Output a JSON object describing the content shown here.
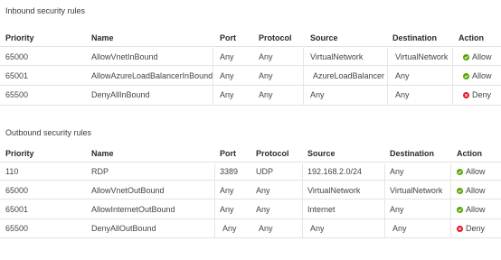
{
  "colors": {
    "allow": "#57a300",
    "deny": "#e81123"
  },
  "inbound": {
    "title": "Inbound security rules",
    "headers": {
      "priority": "Priority",
      "name": "Name",
      "port": "Port",
      "protocol": "Protocol",
      "source": "Source",
      "destination": "Destination",
      "action": "Action"
    },
    "rows": [
      {
        "priority": "65000",
        "name": "AllowVnetInBound",
        "port": "Any",
        "protocol": "Any",
        "source": "VirtualNetwork",
        "destination": "VirtualNetwork",
        "action": "Allow",
        "action_icon": "check-circle-icon"
      },
      {
        "priority": "65001",
        "name": "AllowAzureLoadBalancerInBound",
        "port": "Any",
        "protocol": "Any",
        "source": "AzureLoadBalancer",
        "destination": "Any",
        "action": "Allow",
        "action_icon": "check-circle-icon"
      },
      {
        "priority": "65500",
        "name": "DenyAllInBound",
        "port": "Any",
        "protocol": "Any",
        "source": "Any",
        "destination": "Any",
        "action": "Deny",
        "action_icon": "x-circle-icon"
      }
    ]
  },
  "outbound": {
    "title": "Outbound security rules",
    "headers": {
      "priority": "Priority",
      "name": "Name",
      "port": "Port",
      "protocol": "Protocol",
      "source": "Source",
      "destination": "Destination",
      "action": "Action"
    },
    "rows": [
      {
        "priority": "110",
        "name": "RDP",
        "port": "3389",
        "protocol": "UDP",
        "source": "192.168.2.0/24",
        "destination": "Any",
        "action": "Allow",
        "action_icon": "check-circle-icon"
      },
      {
        "priority": "65000",
        "name": "AllowVnetOutBound",
        "port": "Any",
        "protocol": "Any",
        "source": "VirtualNetwork",
        "destination": "VirtualNetwork",
        "action": "Allow",
        "action_icon": "check-circle-icon"
      },
      {
        "priority": "65001",
        "name": "AllowInternetOutBound",
        "port": "Any",
        "protocol": "Any",
        "source": "Internet",
        "destination": "Any",
        "action": "Allow",
        "action_icon": "check-circle-icon"
      },
      {
        "priority": "65500",
        "name": "DenyAllOutBound",
        "port": "Any",
        "protocol": "Any",
        "source": "Any",
        "destination": "Any",
        "action": "Deny",
        "action_icon": "x-circle-icon"
      }
    ]
  }
}
